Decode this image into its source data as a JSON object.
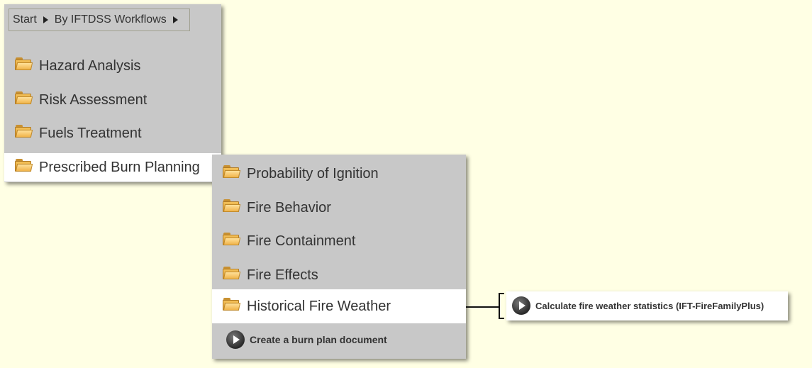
{
  "breadcrumb": {
    "items": [
      "Start",
      "By IFTDSS Workflows"
    ]
  },
  "menu1": {
    "items": [
      {
        "label": "Hazard Analysis",
        "icon": "folder-icon",
        "active": false
      },
      {
        "label": "Risk Assessment",
        "icon": "folder-icon",
        "active": false
      },
      {
        "label": "Fuels Treatment",
        "icon": "folder-icon",
        "active": false
      },
      {
        "label": "Prescribed Burn Planning",
        "icon": "folder-icon",
        "active": true
      }
    ]
  },
  "menu2": {
    "items": [
      {
        "label": "Probability of Ignition",
        "icon": "folder-icon",
        "active": false
      },
      {
        "label": "Fire Behavior",
        "icon": "folder-icon",
        "active": false
      },
      {
        "label": "Fire Containment",
        "icon": "folder-icon",
        "active": false
      },
      {
        "label": "Fire Effects",
        "icon": "folder-icon",
        "active": false
      },
      {
        "label": "Historical Fire Weather",
        "icon": "folder-icon",
        "active": true
      }
    ],
    "action": {
      "label": "Create a burn plan document",
      "icon": "play-icon"
    }
  },
  "submenu": {
    "action": {
      "label": "Calculate fire weather statistics (IFT-FireFamilyPlus)",
      "icon": "play-icon"
    }
  },
  "colors": {
    "background": "#ffffe4",
    "panel": "#c8c8c8",
    "active_item": "#ffffff",
    "text": "#333333"
  }
}
